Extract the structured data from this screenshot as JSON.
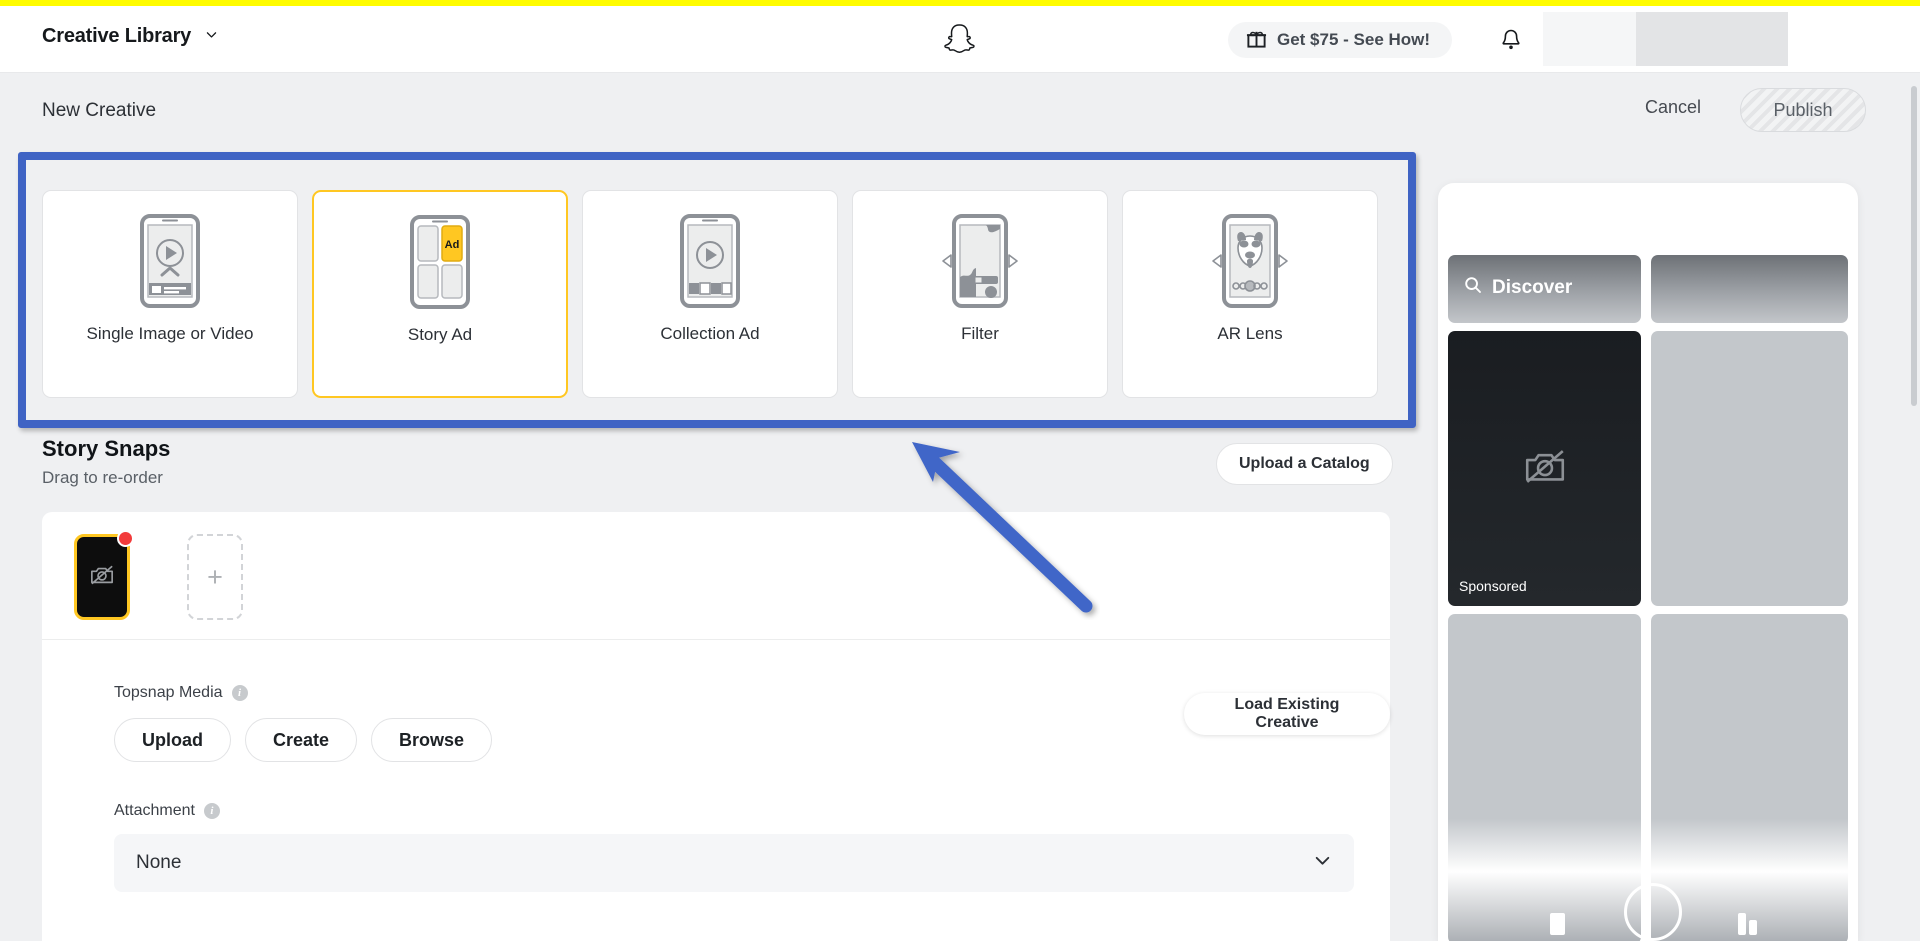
{
  "topnav": {
    "brand_title": "Creative Library",
    "brand_chevron_icon": "chevron-down-icon",
    "logo_icon": "snapchat-ghost-icon",
    "promo_label": "Get $75 - See How!",
    "promo_icon": "gift-icon",
    "notification_icon": "bell-icon"
  },
  "header": {
    "page_title": "New Creative",
    "cancel_label": "Cancel",
    "publish_label": "Publish"
  },
  "formats": {
    "items": [
      {
        "label": "Single Image or Video",
        "icon": "phone-play-video-icon",
        "selected": false
      },
      {
        "label": "Story Ad",
        "icon": "phone-story-grid-icon",
        "selected": true,
        "tile_label": "Ad"
      },
      {
        "label": "Collection Ad",
        "icon": "phone-collection-icon",
        "selected": false
      },
      {
        "label": "Filter",
        "icon": "phone-filter-icon",
        "selected": false
      },
      {
        "label": "AR Lens",
        "icon": "phone-ar-lens-dog-icon",
        "selected": false
      }
    ]
  },
  "snaps": {
    "title": "Story Snaps",
    "subtitle": "Drag to re-order",
    "catalog_button": "Upload a Catalog",
    "tile_icon": "no-media-camera-icon",
    "add_tile_icon": "plus-icon"
  },
  "topsnap": {
    "label": "Topsnap Media",
    "info_icon": "info-icon",
    "buttons": [
      "Upload",
      "Create",
      "Browse"
    ],
    "load_existing_label": "Load Existing Creative"
  },
  "attachment": {
    "label": "Attachment",
    "info_icon": "info-icon",
    "value": "None",
    "chevron_icon": "chevron-down-icon"
  },
  "preview": {
    "discover_label": "Discover",
    "search_icon": "search-icon",
    "sponsored_label": "Sponsored",
    "media_icon": "no-media-camera-icon",
    "camera_icon": "camera-circle-icon"
  },
  "annotation": {
    "highlight_color": "#3f63c4",
    "arrow_color": "#4066c8",
    "arrow_name": "pointer-arrow"
  },
  "colors": {
    "brand_yellow": "#fffc00",
    "selected_border": "#ffc722",
    "badge_red": "#f23b3b",
    "page_bg": "#eff0f2"
  }
}
